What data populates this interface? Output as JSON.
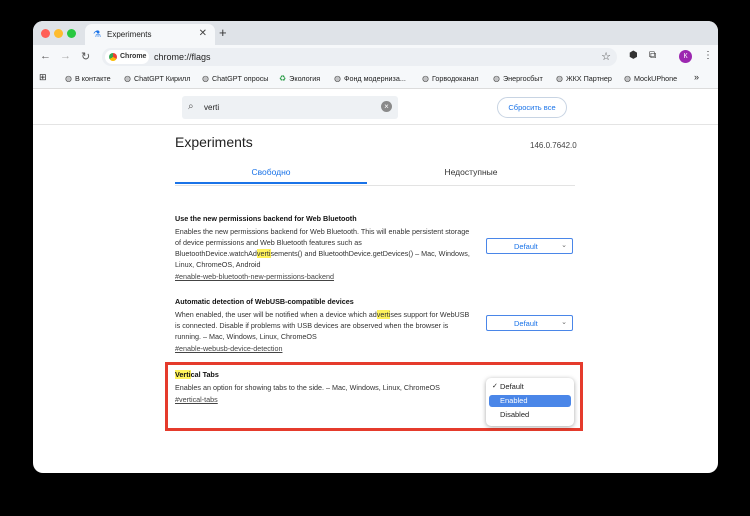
{
  "tab": {
    "title": "Experiments",
    "close": "✕",
    "new_tab": "+"
  },
  "window_controls": {
    "colors": [
      "#ff5f57",
      "#febc2e",
      "#28c840"
    ]
  },
  "toolbar": {
    "back": "←",
    "forward": "→",
    "reload": "↻",
    "chip_label": "Chrome",
    "url": "chrome://flags",
    "avatar_letter": "К"
  },
  "bookmarks": [
    {
      "icon": "globe-icon",
      "label": "В контакте"
    },
    {
      "icon": "globe-icon",
      "label": "ChatGPT Кирилл"
    },
    {
      "icon": "globe-icon",
      "label": "ChatGPT опросы"
    },
    {
      "icon": "recycle-icon",
      "label": "Экология"
    },
    {
      "icon": "globe-icon",
      "label": "Фонд модерниза..."
    },
    {
      "icon": "globe-icon",
      "label": "Горводоканал"
    },
    {
      "icon": "globe-icon",
      "label": "Энергосбыт"
    },
    {
      "icon": "globe-icon",
      "label": "ЖКХ Партнер"
    },
    {
      "icon": "globe-icon",
      "label": "MockUPhone"
    }
  ],
  "bookmarks_more": "»",
  "search": {
    "value": "verti",
    "reset_label": "Сбросить все"
  },
  "page": {
    "title": "Experiments",
    "version": "146.0.7642.0",
    "tab_available": "Свободно",
    "tab_unavailable": "Недоступные"
  },
  "flags": [
    {
      "title": "Use the new permissions backend for Web Bluetooth",
      "desc_pre": "Enables the new permissions backend for Web Bluetooth. This will enable persistent storage of device permissions and Web Bluetooth features such as BluetoothDevice.watchAd",
      "desc_hl": "verti",
      "desc_post": "sements() and BluetoothDevice.getDevices() – Mac, Windows, Linux, ChromeOS, Android",
      "link": "#enable-web-bluetooth-new-permissions-backend",
      "value": "Default"
    },
    {
      "title": "Automatic detection of WebUSB-compatible devices",
      "desc_pre": "When enabled, the user will be notified when a device which ad",
      "desc_hl": "verti",
      "desc_post": "ses support for WebUSB is connected. Disable if problems with USB devices are observed when the browser is running. – Mac, Windows, Linux, ChromeOS",
      "link": "#enable-webusb-device-detection",
      "value": "Default"
    },
    {
      "title_hl": "Verti",
      "title_post": "cal Tabs",
      "desc": "Enables an option for showing tabs to the side. – Mac, Windows, Linux, ChromeOS",
      "link": "#vertical-tabs",
      "options": [
        "Default",
        "Enabled",
        "Disabled"
      ],
      "checked_option": "Default",
      "highlighted_option": "Enabled"
    }
  ],
  "colors": {
    "accent": "#1a73e8",
    "highlight": "#fff35c",
    "annotation_red": "#e53b2c"
  }
}
